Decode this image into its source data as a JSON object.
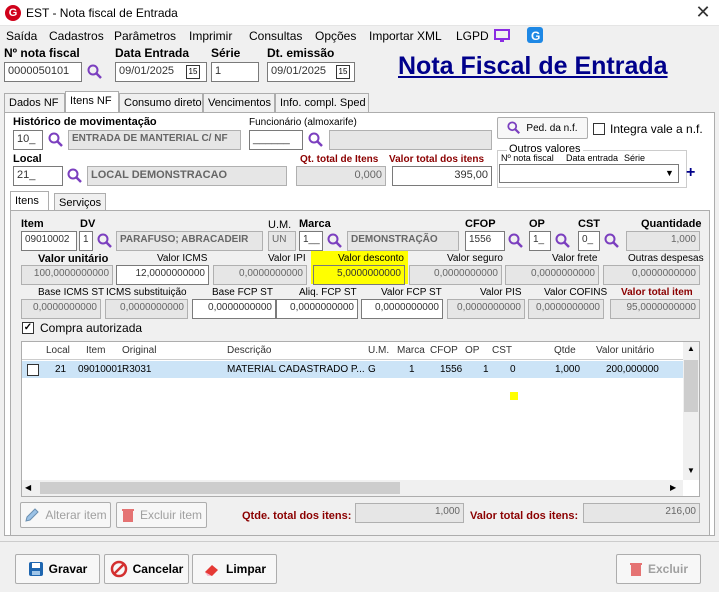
{
  "window": {
    "title": "EST - Nota fiscal de Entrada",
    "app_icon": "G",
    "close": "✕"
  },
  "menu": [
    "Saída",
    "Cadastros",
    "Parâmetros",
    "Imprimir",
    "Consultas",
    "Opções",
    "Importar XML",
    "LGPD"
  ],
  "header": {
    "nota_label": "Nº nota fiscal",
    "nota_value": "0000050101",
    "data_entrada_label": "Data Entrada",
    "data_entrada_value": "09/01/2025",
    "serie_label": "Série",
    "serie_value": "1",
    "dt_emissao_label": "Dt. emissão",
    "dt_emissao_value": "09/01/2025",
    "big_title": "Nota Fiscal de Entrada",
    "cal_glyph": "15"
  },
  "tabs": [
    "Dados NF",
    "Itens NF",
    "Consumo direto",
    "Vencimentos",
    "Info. compl. Sped"
  ],
  "itens_nf": {
    "historico_label": "Histórico de movimentação",
    "historico_code": "10_",
    "historico_desc": "ENTRADA DE MANTERIAL C/ NF",
    "funcionario_label": "Funcionário (almoxarife)",
    "funcionario_code": "______",
    "ped_button": "Ped. da n.f.",
    "integra_label": "Integra vale a n.f.",
    "local_label": "Local",
    "local_code": "21_",
    "local_desc": "LOCAL DEMONSTRACAO",
    "qt_total_label": "Qt. total de Itens",
    "qt_total_value": "0,000",
    "valor_total_label": "Valor total dos itens",
    "valor_total_value": "395,00",
    "outros_valores_label": "Outros valores",
    "outros_cols": [
      "Nº nota fiscal",
      "Data entrada",
      "Série"
    ],
    "plus": "+"
  },
  "subtabs": [
    "Itens",
    "Serviços"
  ],
  "item": {
    "item_label": "Item",
    "item_value": "09010002",
    "dv_label": "DV",
    "dv_value": "1",
    "desc_value": "PARAFUSO; ABRACADEIR",
    "um_label": "U.M.",
    "um_value": "UN",
    "marca_label": "Marca",
    "marca_code": "1__",
    "marca_desc": "DEMONSTRAÇÃO",
    "cfop_label": "CFOP",
    "cfop_value": "1556",
    "op_label": "OP",
    "op_value": "1_",
    "cst_label": "CST",
    "cst_value": "0_",
    "quantidade_label": "Quantidade",
    "quantidade_value": "1,000"
  },
  "valores1": [
    {
      "label": "Valor unitário",
      "value": "100,0000000000"
    },
    {
      "label": "Valor ICMS",
      "value": "12,0000000000"
    },
    {
      "label": "Valor IPI",
      "value": "0,0000000000"
    },
    {
      "label": "Valor desconto",
      "value": "5,0000000000"
    },
    {
      "label": "Valor seguro",
      "value": "0,0000000000"
    },
    {
      "label": "Valor frete",
      "value": "0,0000000000"
    },
    {
      "label": "Outras despesas",
      "value": "0,0000000000"
    }
  ],
  "valores2": [
    {
      "label": "Base ICMS ST",
      "value": "0,0000000000"
    },
    {
      "label": "ICMS substituição",
      "value": "0,0000000000"
    },
    {
      "label": "Base FCP ST",
      "value": "0,0000000000"
    },
    {
      "label": "Aliq. FCP ST",
      "value": "0,0000000000"
    },
    {
      "label": "Valor FCP ST",
      "value": "0,0000000000"
    },
    {
      "label": "Valor PIS",
      "value": "0,0000000000"
    },
    {
      "label": "Valor COFINS",
      "value": "0,0000000000"
    },
    {
      "label": "Valor total item",
      "value": "95,0000000000"
    }
  ],
  "compra_autorizada_label": "Compra autorizada",
  "grid": {
    "columns": [
      "Local",
      "Item",
      "Original",
      "Descrição",
      "U.M.",
      "Marca",
      "CFOP",
      "OP",
      "CST",
      "Qtde",
      "Valor unitário"
    ],
    "rows": [
      {
        "local": "21",
        "item": "09010001",
        "original": "R3031",
        "descricao": "MATERIAL CADASTRADO P...",
        "um": "G",
        "marca": "1",
        "cfop": "1556",
        "op": "1",
        "cst": "0",
        "qtde": "1,000",
        "valor": "200,000000"
      }
    ]
  },
  "bottom": {
    "alterar": "Alterar item",
    "excluir_item": "Excluir item",
    "qtde_total_label": "Qtde. total dos itens:",
    "qtde_total_value": "1,000",
    "valor_total_label": "Valor total dos itens:",
    "valor_total_value": "216,00"
  },
  "footer": {
    "gravar": "Gravar",
    "cancelar": "Cancelar",
    "limpar": "Limpar",
    "excluir": "Excluir"
  },
  "colors": {
    "title_blue": "#00008b",
    "label_red": "#8b0000",
    "highlight": "#ffff00",
    "row_select": "#cce4f7"
  }
}
